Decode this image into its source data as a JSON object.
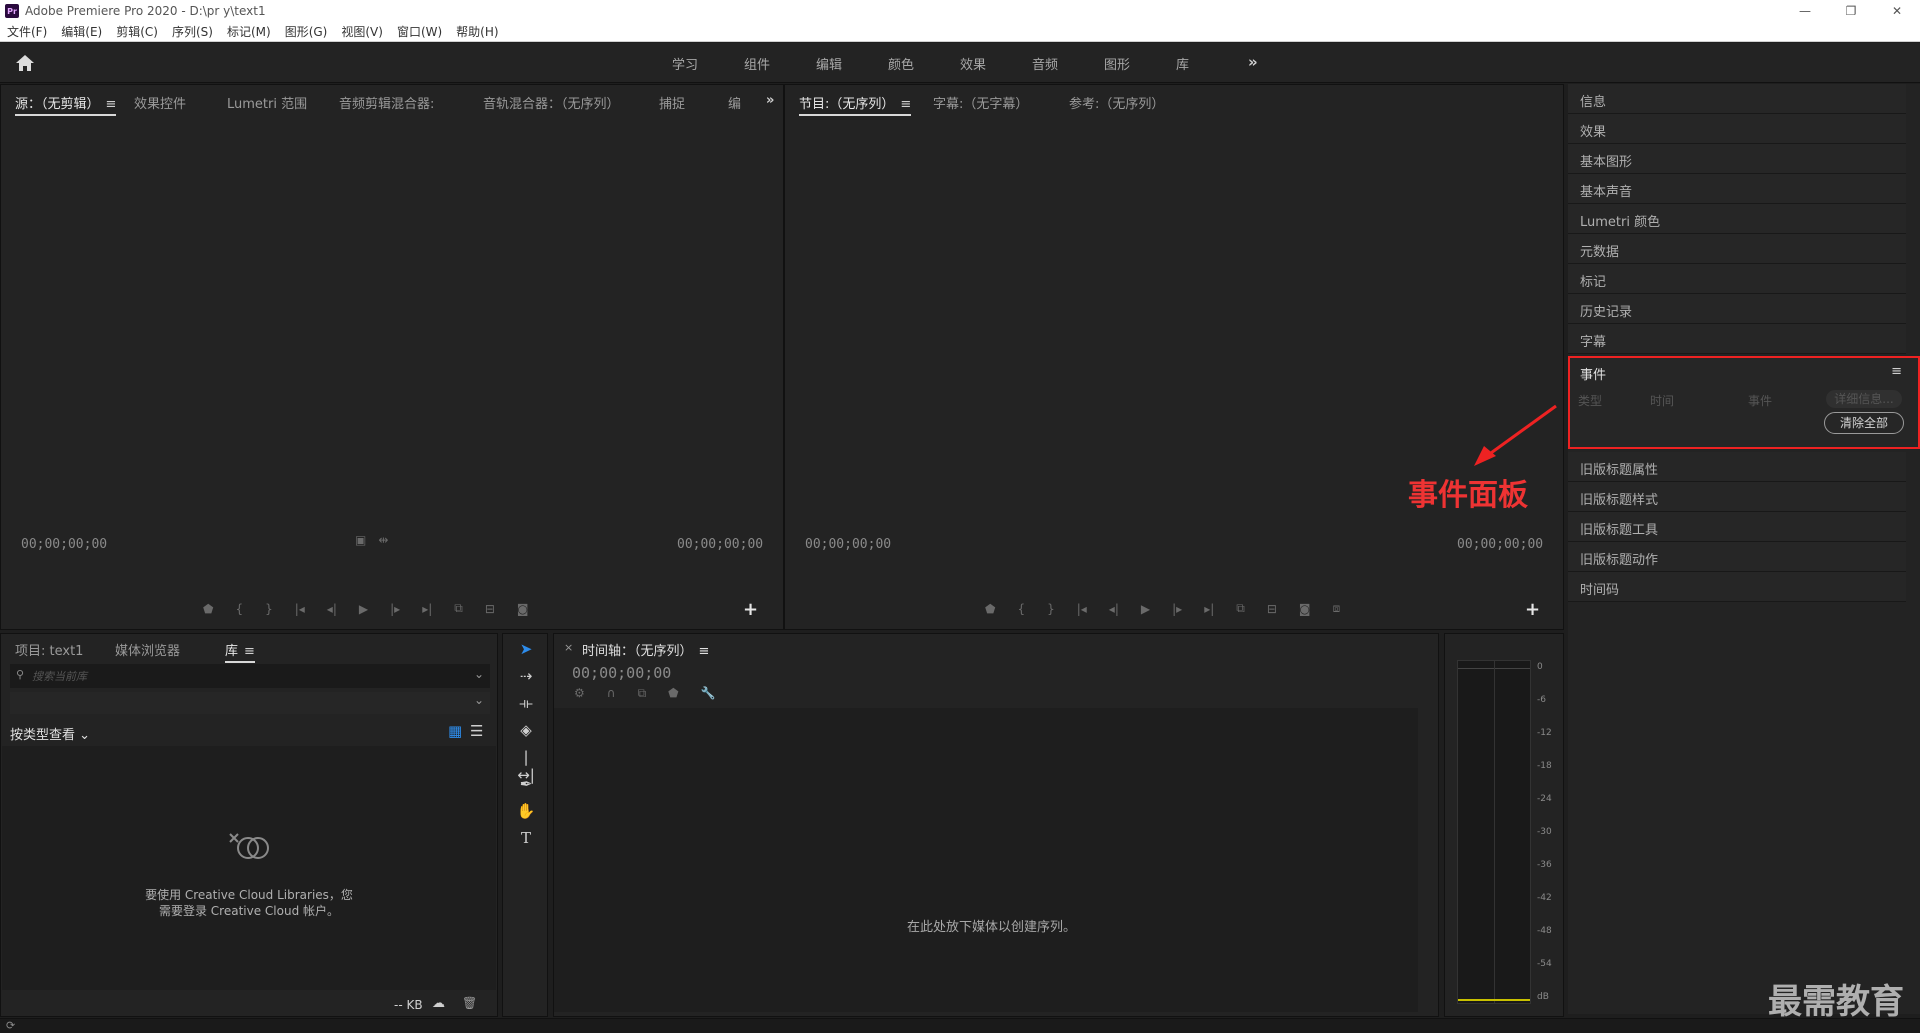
{
  "window": {
    "title": "Adobe Premiere Pro 2020 - D:\\pr y\\text1",
    "app_icon": "Pr",
    "controls": [
      "—",
      "❐",
      "✕"
    ]
  },
  "menu": [
    "文件(F)",
    "编辑(E)",
    "剪辑(C)",
    "序列(S)",
    "标记(M)",
    "图形(G)",
    "视图(V)",
    "窗口(W)",
    "帮助(H)"
  ],
  "workspaces": [
    "学习",
    "组件",
    "编辑",
    "颜色",
    "效果",
    "音频",
    "图形",
    "库"
  ],
  "source_panel": {
    "tabs": [
      "源：（无剪辑）",
      "效果控件",
      "Lumetri 范围",
      "音频剪辑混合器:",
      "音轨混合器：（无序列）",
      "捕捉",
      "编"
    ],
    "tc_left": "00;00;00;00",
    "tc_right": "00;00;00;00"
  },
  "program_panel": {
    "tabs": [
      "节目:（无序列）",
      "字幕:（无字幕）",
      "参考:（无序列）"
    ],
    "tc_left": "00;00;00;00",
    "tc_right": "00;00;00;00"
  },
  "right_panels": [
    "信息",
    "效果",
    "基本图形",
    "基本声音",
    "Lumetri 颜色",
    "元数据",
    "标记",
    "历史记录",
    "字幕"
  ],
  "events": {
    "title": "事件",
    "columns": [
      "类型",
      "时间",
      "事件"
    ],
    "details_button": "详细信息...",
    "clear_button": "清除全部"
  },
  "right_panels_lower": [
    "旧版标题属性",
    "旧版标题样式",
    "旧版标题工具",
    "旧版标题动作",
    "时间码"
  ],
  "annotation": {
    "label": "事件面板",
    "color": "#e22222"
  },
  "project_panel": {
    "tabs": [
      "项目: text1",
      "媒体浏览器",
      "库"
    ],
    "search_placeholder": "搜索当前库",
    "view_label": "按类型查看",
    "cc_message_line1": "要使用 Creative Cloud Libraries，您",
    "cc_message_line2": "需要登录 Creative Cloud 帐户。",
    "size_label": "-- KB"
  },
  "timeline": {
    "title": "时间轴：（无序列）",
    "timecode": "00;00;00;00",
    "drop_message": "在此处放下媒体以创建序列。"
  },
  "meter": {
    "scale": [
      "0",
      "-6",
      "-12",
      "-18",
      "-24",
      "-30",
      "-36",
      "-42",
      "-48",
      "-54",
      "dB"
    ]
  },
  "watermark": "最需教育",
  "colors": {
    "accent_blue": "#2d8ceb",
    "annotation_red": "#e22222"
  }
}
